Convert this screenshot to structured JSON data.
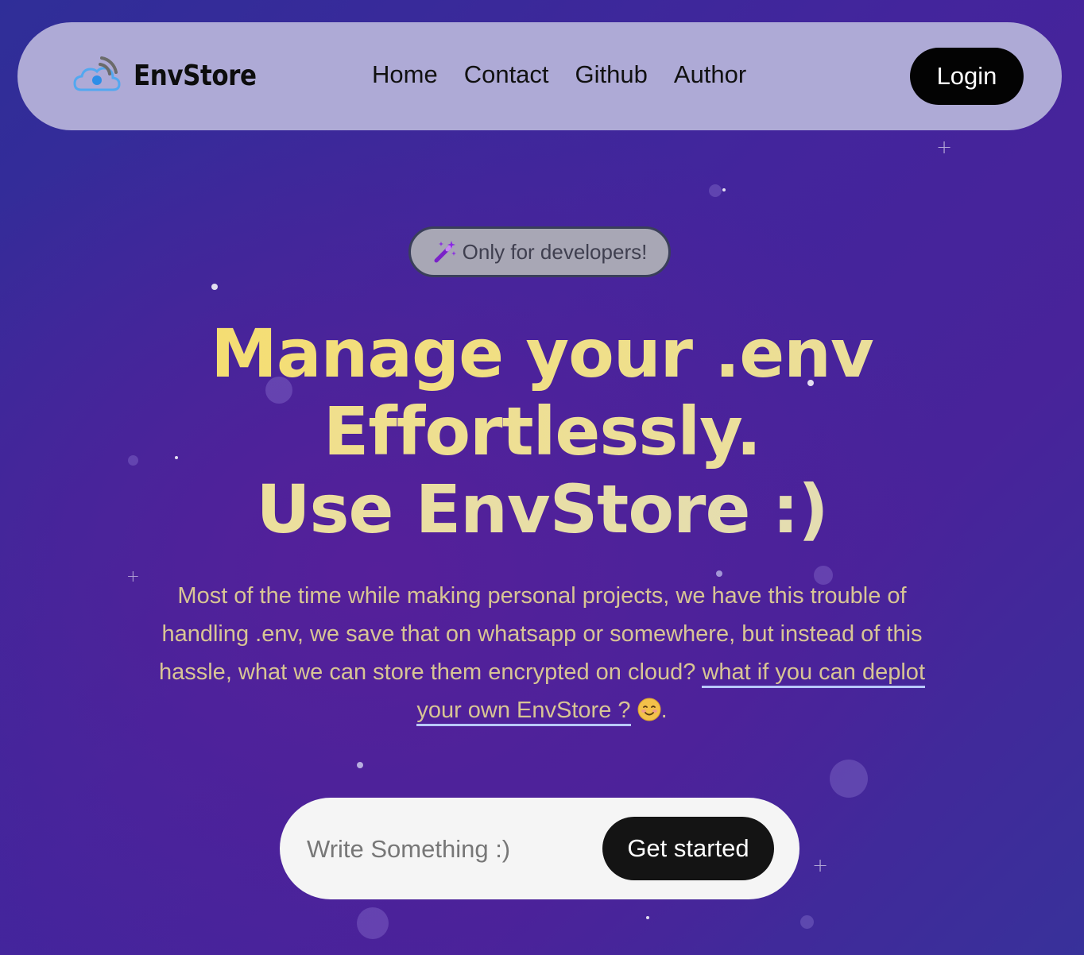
{
  "brand": {
    "name": "EnvStore",
    "logo_icon": "cloud-wifi-icon"
  },
  "nav": {
    "links": [
      {
        "label": "Home"
      },
      {
        "label": "Contact"
      },
      {
        "label": "Github"
      },
      {
        "label": "Author"
      }
    ],
    "login_label": "Login"
  },
  "badge": {
    "icon": "magic-wand-icon",
    "text": "Only for developers!"
  },
  "hero": {
    "headline_line1": "Manage your .env",
    "headline_line2": "Effortlessly.",
    "headline_line3": "Use EnvStore :)",
    "description_text": "Most of the time while making personal projects, we have this trouble of handling .env, we save that on whatsapp or somewhere, but instead of this hassle, what we can store them encrypted on cloud? ",
    "description_link": "what if you can deplot your own EnvStore ?",
    "description_emoji": "smiling-face-icon",
    "description_end": "."
  },
  "cta": {
    "input_placeholder": "Write Something :)",
    "button_label": "Get started"
  },
  "colors": {
    "background_start": "#2f2e98",
    "background_mid": "#48239a",
    "navbar": "#aeaad6",
    "headline": "#f7dc66",
    "description": "#d8c594",
    "login_button": "#030303",
    "cta_button": "#141414"
  }
}
